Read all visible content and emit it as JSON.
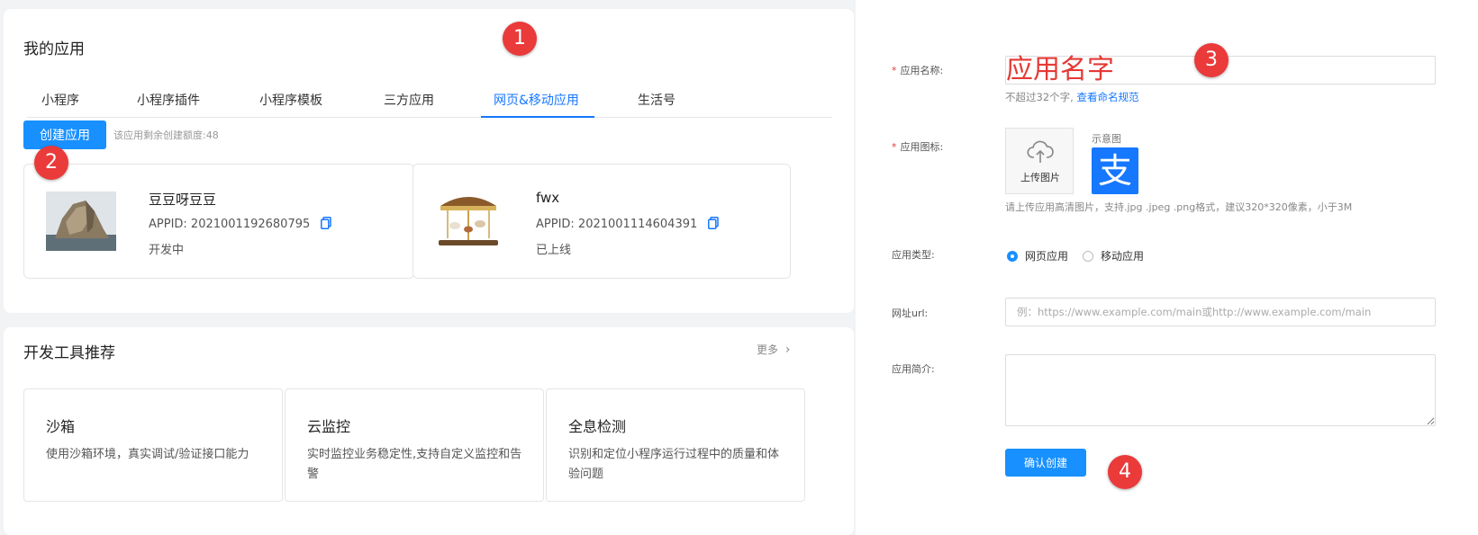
{
  "left": {
    "my_apps": {
      "title": "我的应用",
      "tabs": [
        "小程序",
        "小程序插件",
        "小程序模板",
        "三方应用",
        "网页&移动应用",
        "生活号"
      ],
      "create_button": "创建应用",
      "quota_text": "该应用剩余创建额度:48",
      "apps": [
        {
          "name": "豆豆呀豆豆",
          "appid": "APPID: 2021001192680795",
          "status": "开发中"
        },
        {
          "name": "fwx",
          "appid": "APPID: 2021001114604391",
          "status": "已上线"
        }
      ]
    },
    "tools": {
      "title": "开发工具推荐",
      "more": "更多",
      "cards": [
        {
          "title": "沙箱",
          "desc": "使用沙箱环境，真实调试/验证接口能力"
        },
        {
          "title": "云监控",
          "desc": "实时监控业务稳定性,支持自定义监控和告警"
        },
        {
          "title": "全息检测",
          "desc": "识别和定位小程序运行过程中的质量和体验问题"
        }
      ]
    }
  },
  "form": {
    "name_label": "应用名称:",
    "name_overlay": "应用名字",
    "name_help_prefix": "不超过32个字,",
    "name_help_link": "查看命名规范",
    "icon_label": "应用图标:",
    "upload_text": "上传图片",
    "sample_label": "示意图",
    "sample_icon_char": "支",
    "icon_help": "请上传应用高清图片，支持.jpg .jpeg .png格式，建议320*320像素，小于3M",
    "type_label": "应用类型:",
    "type_options": [
      "网页应用",
      "移动应用"
    ],
    "url_label": "网址url:",
    "url_placeholder": "例：https://www.example.com/main或http://www.example.com/main",
    "intro_label": "应用简介:",
    "submit_button": "确认创建"
  },
  "markers": [
    "1",
    "2",
    "3",
    "4"
  ],
  "colors": {
    "primary": "#1890ff",
    "marker": "#ea3a3a",
    "required": "#e53935",
    "alipay": "#1677ff"
  }
}
